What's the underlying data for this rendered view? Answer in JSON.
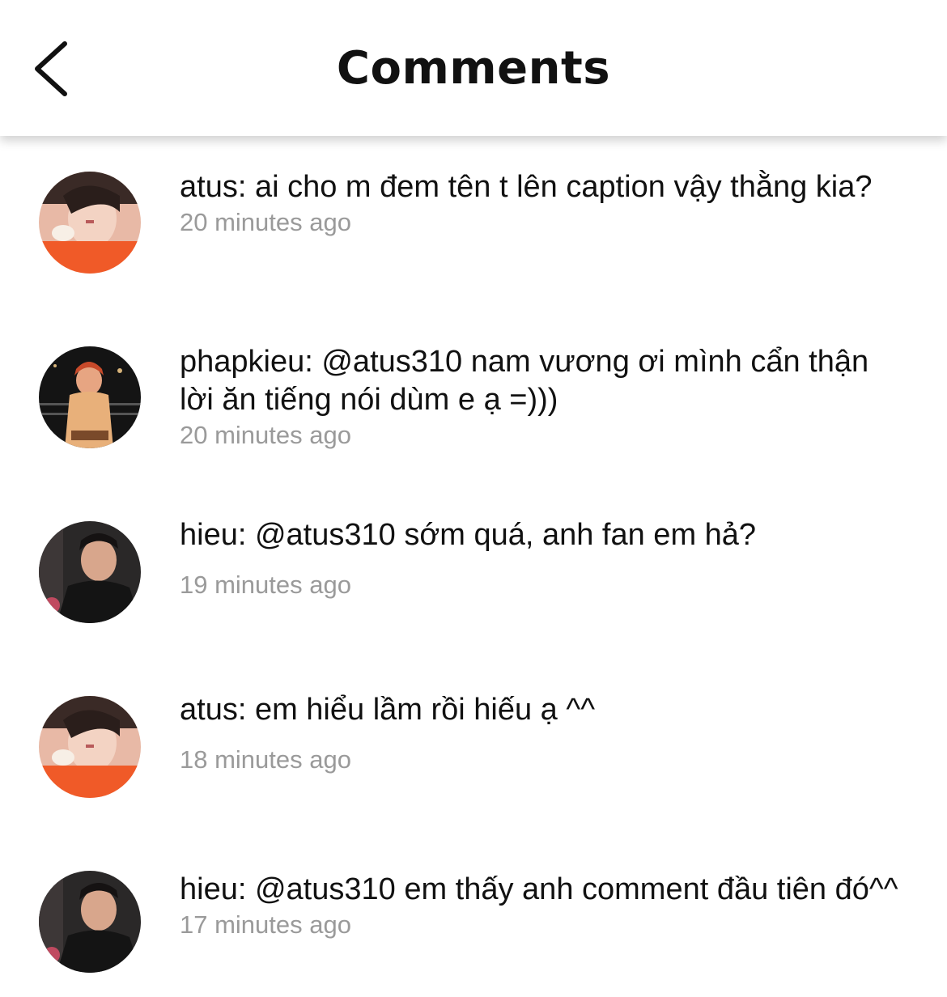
{
  "header": {
    "title": "Comments",
    "back_icon": "chevron-left-icon"
  },
  "comments": [
    {
      "avatar_icon": "avatar-atus",
      "text": "atus: ai cho m đem tên t lên caption vậy thằng kia?",
      "time": "20 minutes ago"
    },
    {
      "avatar_icon": "avatar-phapkieu",
      "text": "phapkieu: @atus310 nam vương ơi mình cẩn thận lời ăn tiếng nói dùm e ạ =)))",
      "time": "20 minutes ago"
    },
    {
      "avatar_icon": "avatar-hieu",
      "text": "hieu: @atus310 sớm quá, anh fan em hả?",
      "time": "19 minutes ago"
    },
    {
      "avatar_icon": "avatar-atus",
      "text": "atus: em hiểu lầm rồi hiếu ạ ^^",
      "time": "18 minutes ago"
    },
    {
      "avatar_icon": "avatar-hieu",
      "text": "hieu: @atus310 em thấy anh comment đầu tiên đó^^",
      "time": "17 minutes ago"
    }
  ],
  "colors": {
    "text": "#111111",
    "timestamp": "#9a9a9a",
    "atus_shirt": "#f05a28",
    "hieu_bg": "#1a1a1a",
    "phapkieu_bg": "#141414"
  }
}
